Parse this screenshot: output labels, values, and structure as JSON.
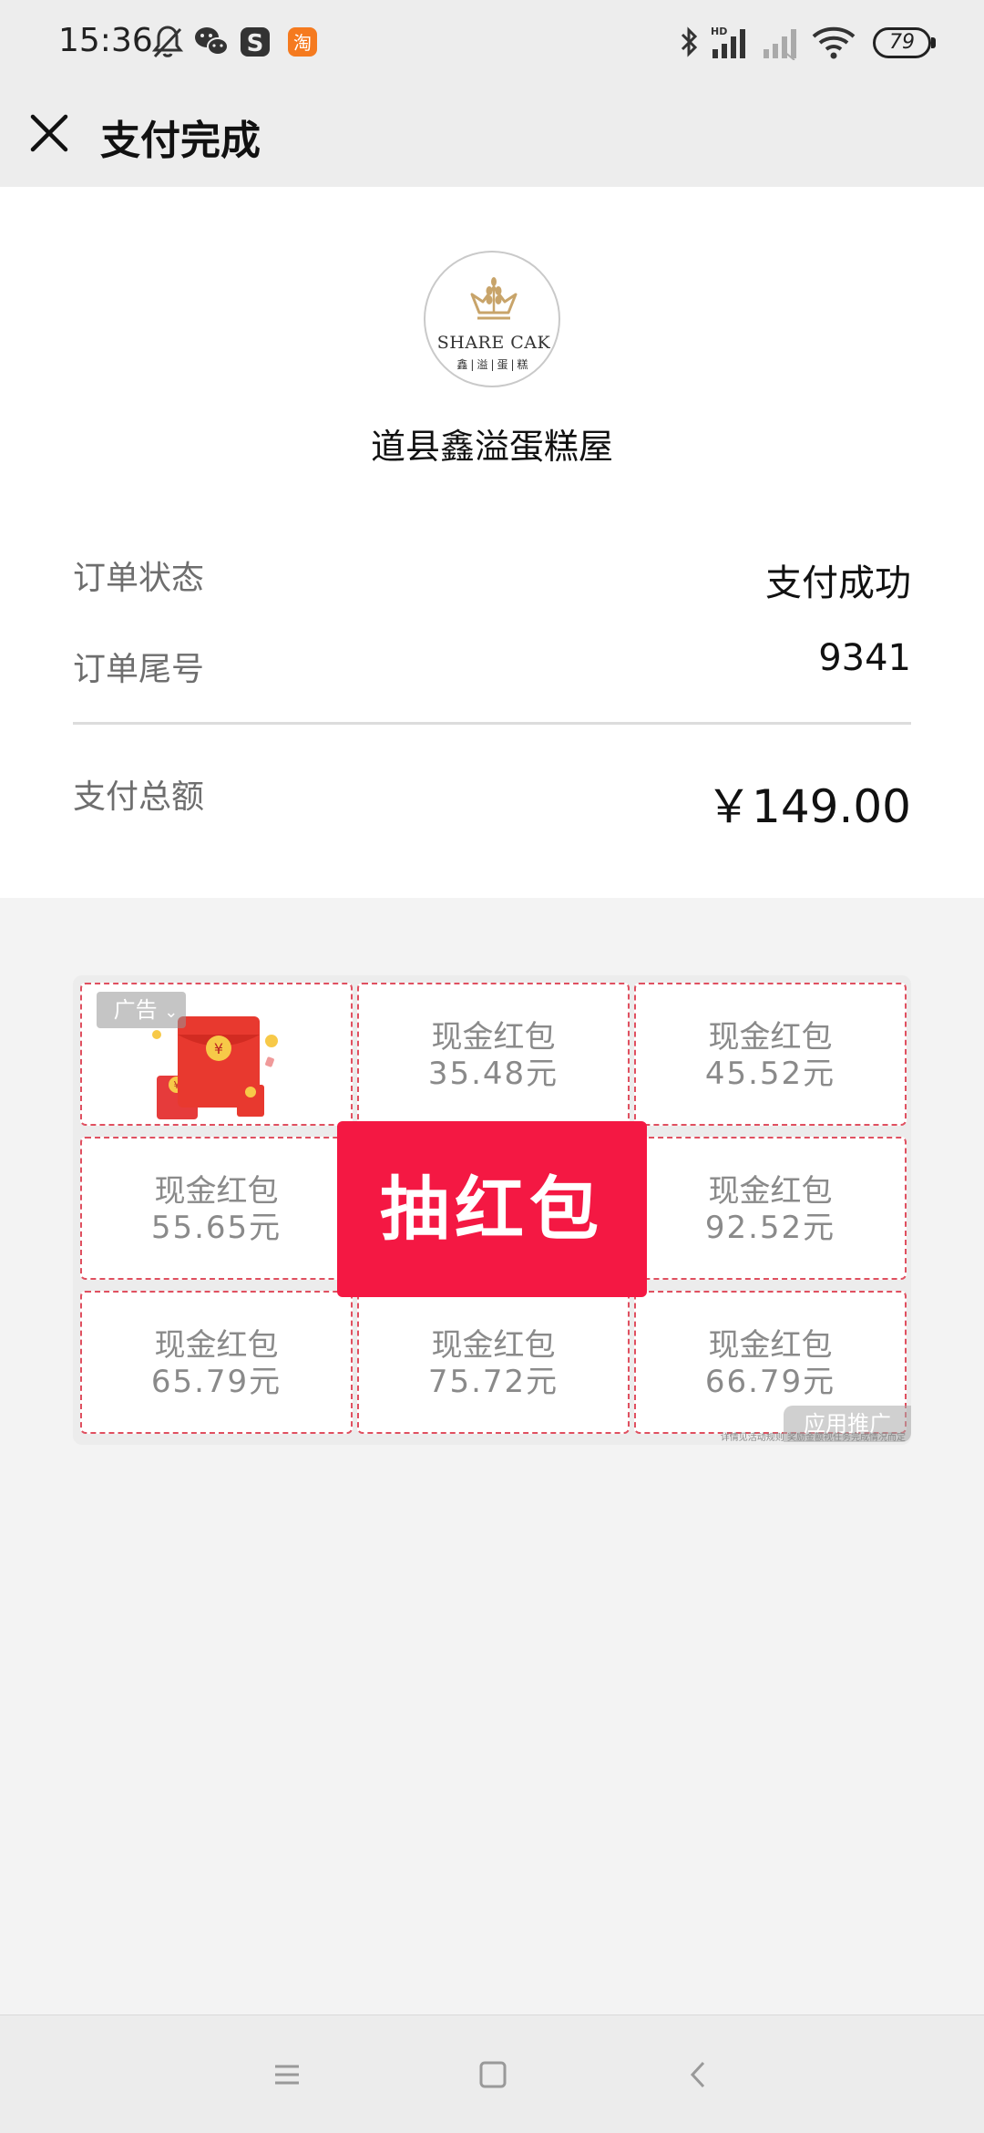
{
  "status_bar": {
    "time": "15:36",
    "battery": "79",
    "left_icons": [
      "bell-off-icon",
      "wechat-icon",
      "s-app-icon",
      "taobao-icon"
    ],
    "right_icons": [
      "bluetooth-icon",
      "hd-signal-icon",
      "signal-icon",
      "wifi-icon",
      "battery-icon"
    ]
  },
  "header": {
    "title": "支付完成",
    "close_icon": "close-icon"
  },
  "merchant": {
    "logo_text": "SHARE CAK",
    "logo_sub": "鑫|溢|蛋|糕",
    "name": "道县鑫溢蛋糕屋",
    "logo_color": "#c8a46a"
  },
  "order": {
    "status_label": "订单状态",
    "status_value": "支付成功",
    "tail_label": "订单尾号",
    "tail_value": "9341",
    "total_label": "支付总额",
    "total_value": "￥149.00"
  },
  "ad": {
    "tag": "广告",
    "promo_tag": "应用推广",
    "fine_print": "详情见活动规则  奖励金额视任务完成情况而定",
    "draw_button": "抽红包",
    "accent_color": "#f41843",
    "cells": [
      {
        "t1": "现金红包",
        "t2": "35.48元"
      },
      {
        "t1": "现金红包",
        "t2": "45.52元"
      },
      {
        "t1": "现金红包",
        "t2": "55.65元"
      },
      {
        "t1": "现金红包",
        "t2": "92.52元"
      },
      {
        "t1": "现金红包",
        "t2": "65.79元"
      },
      {
        "t1": "现金红包",
        "t2": "75.72元"
      },
      {
        "t1": "现金红包",
        "t2": "66.79元"
      }
    ]
  },
  "nav": {
    "icons": [
      "menu-icon",
      "home-icon",
      "back-icon"
    ]
  }
}
